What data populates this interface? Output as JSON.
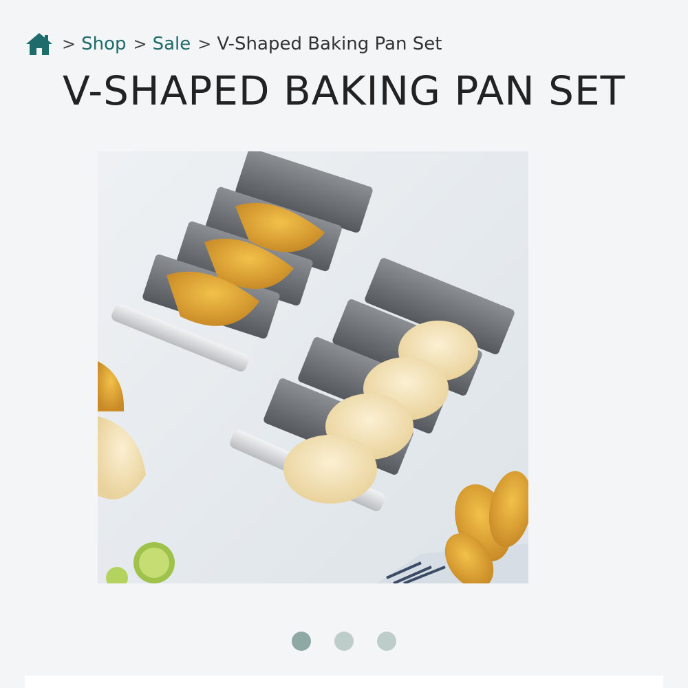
{
  "breadcrumb": {
    "home_icon": "home-icon",
    "separator": ">",
    "items": [
      {
        "label": "Shop",
        "link": true
      },
      {
        "label": "Sale",
        "link": true
      },
      {
        "label": "V-Shaped Baking Pan Set",
        "link": false
      }
    ]
  },
  "product": {
    "title": "V-SHAPED BAKING PAN SET",
    "image_alt": "V-shaped taco baking pans holding tortillas"
  },
  "carousel": {
    "slide_count": 3,
    "active_index": 0
  },
  "colors": {
    "link": "#1f6a6a",
    "dot_active": "#8ea8a4",
    "dot_inactive": "#bccdca"
  }
}
